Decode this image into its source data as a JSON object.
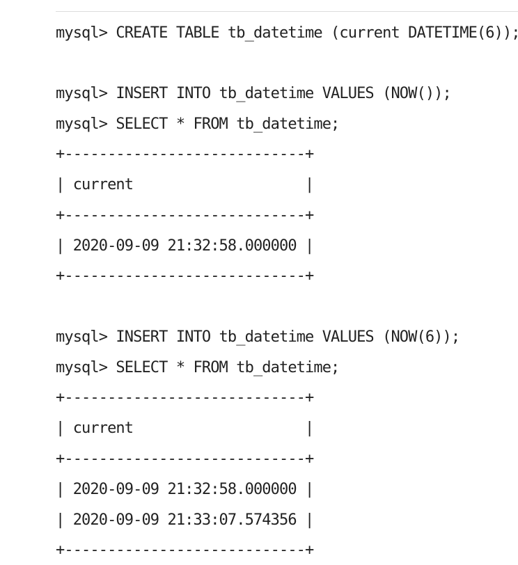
{
  "session": {
    "create_table": "mysql> CREATE TABLE tb_datetime (current DATETIME(6));",
    "block1": {
      "insert": "mysql> INSERT INTO tb_datetime VALUES (NOW());",
      "select": "mysql> SELECT * FROM tb_datetime;",
      "border": "+----------------------------+",
      "header": "| current                    |",
      "rows": [
        "| 2020-09-09 21:32:58.000000 |"
      ]
    },
    "block2": {
      "insert": "mysql> INSERT INTO tb_datetime VALUES (NOW(6));",
      "select": "mysql> SELECT * FROM tb_datetime;",
      "border": "+----------------------------+",
      "header": "| current                    |",
      "rows": [
        "| 2020-09-09 21:32:58.000000 |",
        "| 2020-09-09 21:33:07.574356 |"
      ]
    }
  }
}
